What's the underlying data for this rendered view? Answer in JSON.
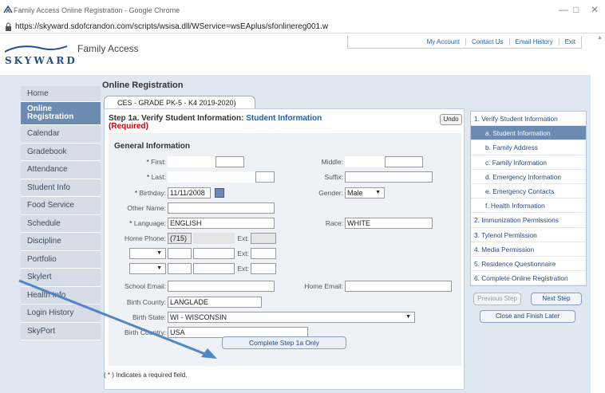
{
  "window": {
    "title": "Family Access Online Registration - Google Chrome",
    "url": "https://skyward.sdofcrandon.com/scripts/wsisa.dll/WService=wsEAplus/sfonlinereg001.w"
  },
  "header": {
    "logo": "SKYWARD",
    "app_title": "Family Access",
    "links": [
      "My Account",
      "Contact Us",
      "Email History",
      "Exit"
    ]
  },
  "nav": [
    "Home",
    "Online Registration",
    "Calendar",
    "Gradebook",
    "Attendance",
    "Student Info",
    "Food Service",
    "Schedule",
    "Discipline",
    "Portfolio",
    "Skylert",
    "Health Info",
    "Login History",
    "SkyPort"
  ],
  "main": {
    "page_title": "Online Registration",
    "tab": "CES - GRADE PK-5 - K4 2019-2020)",
    "step_title": "Step 1a. Verify Student Information:",
    "step_sub": "Student Information",
    "required": "(Required)",
    "undo": "Undo",
    "section": "General Information",
    "labels": {
      "first": "First:",
      "middle": "Middle:",
      "last": "Last:",
      "suffix": "Suffix:",
      "birthday": "Birthday:",
      "gender": "Gender:",
      "other_name": "Other Name:",
      "language": "Language:",
      "race": "Race:",
      "home_phone": "Home Phone:",
      "ext": "Ext:",
      "school_email": "School Email:",
      "home_email": "Home Email:",
      "birth_county": "Birth County:",
      "birth_state": "Birth State:",
      "birth_country": "Birth Country:"
    },
    "values": {
      "birthday": "11/11/2008",
      "gender": "Male",
      "language": "ENGLISH",
      "race": "WHITE",
      "home_phone": "(715)",
      "birth_county": "LANGLADE",
      "birth_state": "WI - WISCONSIN",
      "birth_country": "USA"
    },
    "complete_button": "Complete Step 1a Only",
    "footnote": "( * ) Indicates a required field."
  },
  "steps": [
    {
      "label": "1. Verify Student Information",
      "sub": false,
      "current": false
    },
    {
      "label": "a. Student Information",
      "sub": true,
      "current": true
    },
    {
      "label": "b. Family Address",
      "sub": true,
      "current": false
    },
    {
      "label": "c. Family Information",
      "sub": true,
      "current": false
    },
    {
      "label": "d. Emergency Information",
      "sub": true,
      "current": false
    },
    {
      "label": "e. Emergency Contacts",
      "sub": true,
      "current": false
    },
    {
      "label": "f. Health Information",
      "sub": true,
      "current": false
    },
    {
      "label": "2. Immunization Permissions",
      "sub": false,
      "current": false
    },
    {
      "label": "3. Tylenol Permission",
      "sub": false,
      "current": false
    },
    {
      "label": "4. Media Permission",
      "sub": false,
      "current": false
    },
    {
      "label": "5. Residence Questionnaire",
      "sub": false,
      "current": false
    },
    {
      "label": "6. Complete Online Registration",
      "sub": false,
      "current": false
    }
  ],
  "buttons": {
    "previous": "Previous Step",
    "next": "Next Step",
    "close": "Close and Finish Later"
  }
}
